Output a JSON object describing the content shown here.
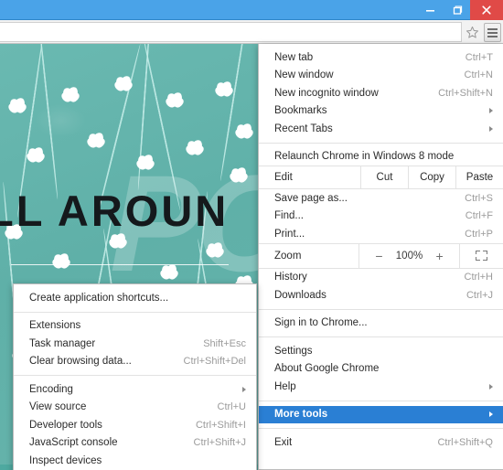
{
  "window": {
    "controls": [
      {
        "name": "minimize",
        "glyph": "minimize-icon"
      },
      {
        "name": "maximize",
        "glyph": "maximize-icon"
      },
      {
        "name": "close",
        "glyph": "close-icon"
      }
    ],
    "titlebar_color": "#4aa3e8",
    "close_color": "#e04a47"
  },
  "toolbar": {
    "omnibox_value": "",
    "omnibox_placeholder": "",
    "star_icon": "star-icon",
    "menu_icon": "hamburger-menu-icon"
  },
  "webpage": {
    "hero_text": "LL AROUN",
    "watermark": "PCRISK",
    "background_color": "#63b3ac"
  },
  "main_menu": {
    "items": [
      {
        "label": "New tab",
        "accel": "Ctrl+T",
        "type": "item"
      },
      {
        "label": "New window",
        "accel": "Ctrl+N",
        "type": "item"
      },
      {
        "label": "New incognito window",
        "accel": "Ctrl+Shift+N",
        "type": "item"
      },
      {
        "label": "Bookmarks",
        "accel": "",
        "type": "submenu"
      },
      {
        "label": "Recent Tabs",
        "accel": "",
        "type": "submenu"
      },
      {
        "type": "separator"
      },
      {
        "label": "Relaunch Chrome in Windows 8 mode",
        "accel": "",
        "type": "item"
      },
      {
        "type": "edit-row"
      },
      {
        "label": "Save page as...",
        "accel": "Ctrl+S",
        "type": "item"
      },
      {
        "label": "Find...",
        "accel": "Ctrl+F",
        "type": "item"
      },
      {
        "label": "Print...",
        "accel": "Ctrl+P",
        "type": "item"
      },
      {
        "type": "zoom-row"
      },
      {
        "label": "History",
        "accel": "Ctrl+H",
        "type": "item"
      },
      {
        "label": "Downloads",
        "accel": "Ctrl+J",
        "type": "item"
      },
      {
        "type": "separator"
      },
      {
        "label": "Sign in to Chrome...",
        "accel": "",
        "type": "item"
      },
      {
        "type": "separator"
      },
      {
        "label": "Settings",
        "accel": "",
        "type": "item"
      },
      {
        "label": "About Google Chrome",
        "accel": "",
        "type": "item"
      },
      {
        "label": "Help",
        "accel": "",
        "type": "submenu"
      },
      {
        "type": "separator"
      },
      {
        "label": "More tools",
        "accel": "",
        "type": "submenu",
        "highlighted": true
      },
      {
        "type": "separator"
      },
      {
        "label": "Exit",
        "accel": "Ctrl+Shift+Q",
        "type": "item"
      }
    ],
    "edit_row": {
      "label": "Edit",
      "buttons": [
        "Cut",
        "Copy",
        "Paste"
      ]
    },
    "zoom_row": {
      "label": "Zoom",
      "minus": "−",
      "value": "100%",
      "plus": "+",
      "fullscreen_icon": "fullscreen-icon"
    },
    "highlight_color": "#2a7fd4"
  },
  "submenu": {
    "items": [
      {
        "label": "Create application shortcuts...",
        "accel": "",
        "type": "item"
      },
      {
        "type": "separator"
      },
      {
        "label": "Extensions",
        "accel": "",
        "type": "item"
      },
      {
        "label": "Task manager",
        "accel": "Shift+Esc",
        "type": "item"
      },
      {
        "label": "Clear browsing data...",
        "accel": "Ctrl+Shift+Del",
        "type": "item"
      },
      {
        "type": "separator"
      },
      {
        "label": "Encoding",
        "accel": "",
        "type": "submenu"
      },
      {
        "label": "View source",
        "accel": "Ctrl+U",
        "type": "item"
      },
      {
        "label": "Developer tools",
        "accel": "Ctrl+Shift+I",
        "type": "item"
      },
      {
        "label": "JavaScript console",
        "accel": "Ctrl+Shift+J",
        "type": "item"
      },
      {
        "label": "Inspect devices",
        "accel": "",
        "type": "item"
      }
    ]
  }
}
